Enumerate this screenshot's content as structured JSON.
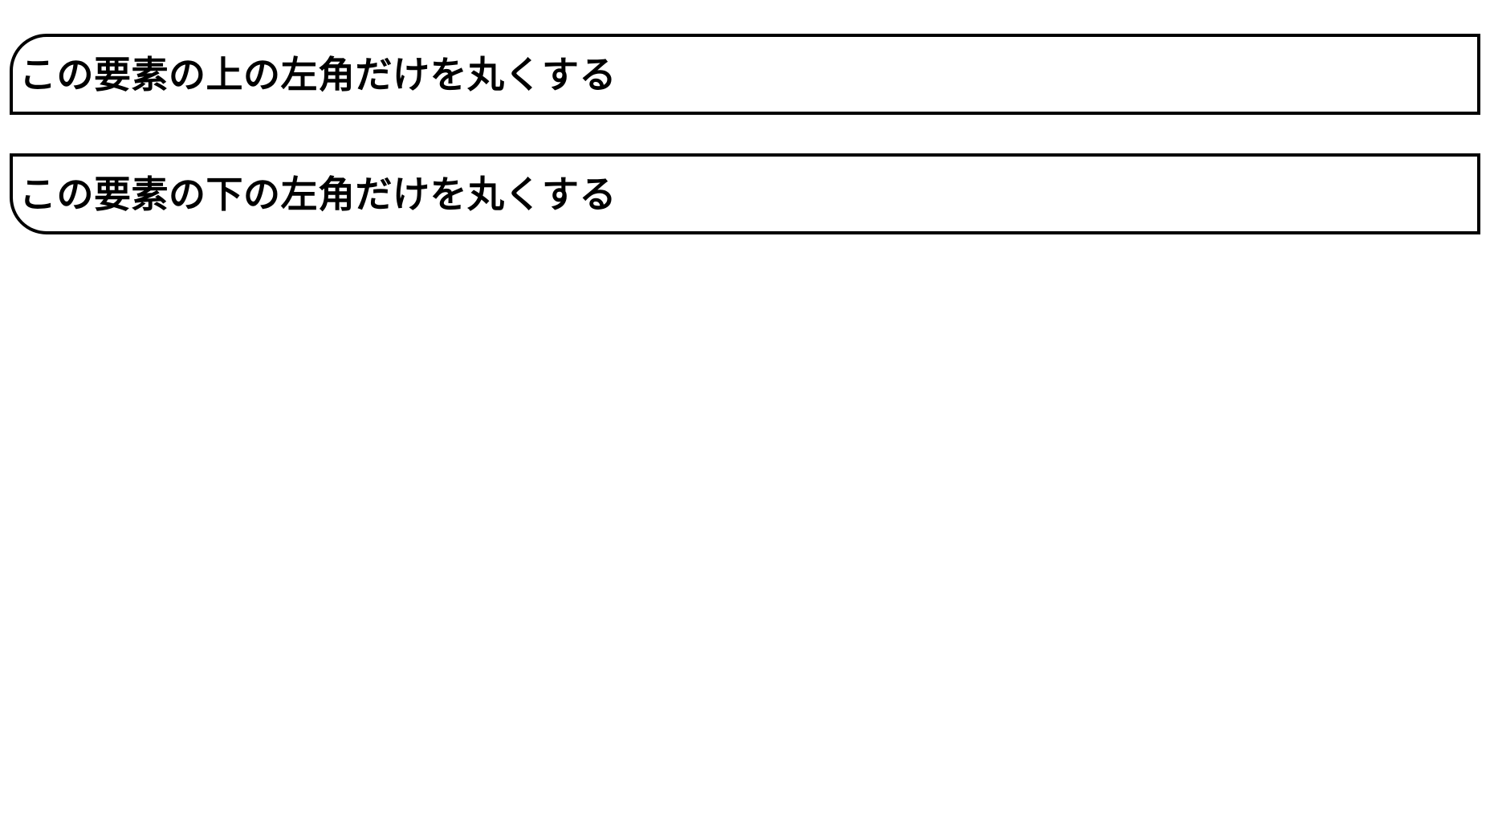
{
  "boxes": {
    "top_left": {
      "text": "この要素の上の左角だけを丸くする"
    },
    "bottom_left": {
      "text": "この要素の下の左角だけを丸くする"
    }
  }
}
